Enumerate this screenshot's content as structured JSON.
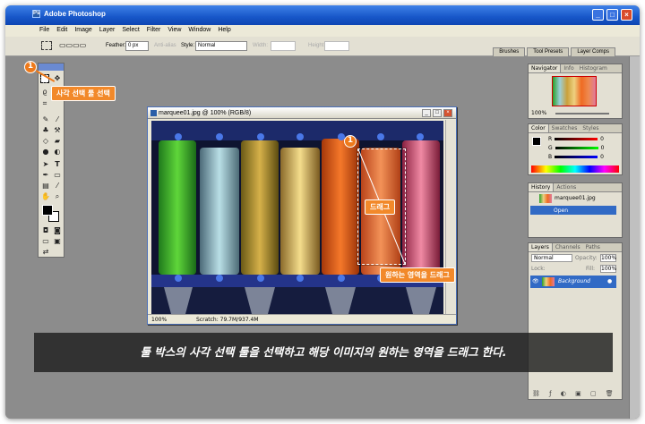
{
  "window": {
    "title": "Adobe Photoshop",
    "min": "_",
    "max": "□",
    "close": "×"
  },
  "menu": [
    "File",
    "Edit",
    "Image",
    "Layer",
    "Select",
    "Filter",
    "View",
    "Window",
    "Help"
  ],
  "options": {
    "feather_label": "Feather:",
    "feather_value": "0 px",
    "antialias": "Anti-alias",
    "style_label": "Style:",
    "style_value": "Normal",
    "width_label": "Width:",
    "height_label": "Height:"
  },
  "palette_well": [
    "Brushes",
    "Tool Presets",
    "Layer Comps"
  ],
  "document": {
    "title": "marquee01.jpg @ 100% (RGB/8)",
    "zoom": "100%",
    "scratch": "Scratch: 79.7M/937.4M"
  },
  "callouts": {
    "step_number": "1",
    "tool_hint": "사각 선택 툴 선택",
    "drag_label": "드래그",
    "drag_hint": "원하는 영역을 드래그"
  },
  "navigator": {
    "tabs": [
      "Navigator",
      "Info",
      "Histogram"
    ],
    "zoom": "100%"
  },
  "color": {
    "tabs": [
      "Color",
      "Swatches",
      "Styles"
    ],
    "channels": [
      {
        "name": "R",
        "value": "0"
      },
      {
        "name": "G",
        "value": "0"
      },
      {
        "name": "B",
        "value": "0"
      }
    ]
  },
  "history": {
    "tabs": [
      "History",
      "Actions"
    ],
    "snapshot": "marquee01.jpg",
    "step": "Open"
  },
  "layers": {
    "tabs": [
      "Layers",
      "Channels",
      "Paths"
    ],
    "blend": "Normal",
    "opacity_label": "Opacity:",
    "opacity": "100%",
    "lock_label": "Lock:",
    "fill_label": "Fill:",
    "fill": "100%",
    "layer_name": "Background"
  },
  "caption": "툴 박스의 사각 선택 툴을 선택하고 해당 이미지의 원하는 영역을 드래그 한다."
}
